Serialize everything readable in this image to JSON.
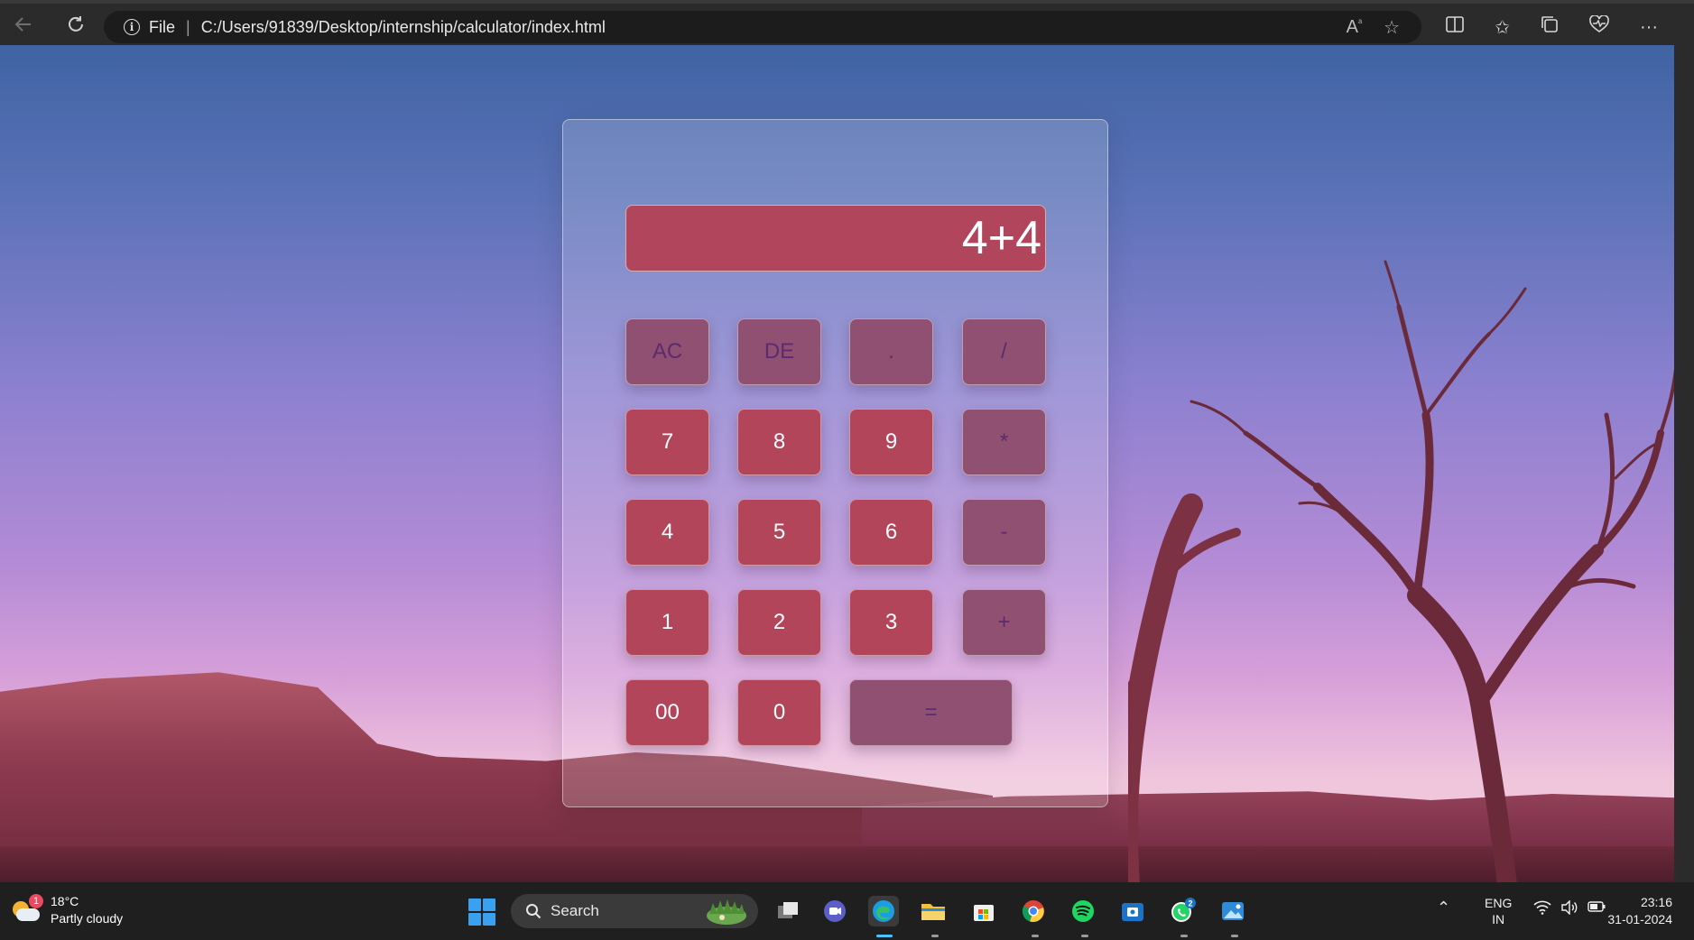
{
  "browser": {
    "url_prefix": "File",
    "url": "C:/Users/91839/Desktop/internship/calculator/index.html"
  },
  "calculator": {
    "display_value": "4+4",
    "keys": {
      "ac": "AC",
      "de": "DE",
      "dot": ".",
      "divide": "/",
      "seven": "7",
      "eight": "8",
      "nine": "9",
      "multiply": "*",
      "four": "4",
      "five": "5",
      "six": "6",
      "minus": "-",
      "one": "1",
      "two": "2",
      "three": "3",
      "plus": "+",
      "double_zero": "00",
      "zero": "0",
      "equals": "="
    },
    "colors": {
      "number_key": "#b3455a",
      "operator_key": "#8f5072",
      "display_bg": "#b0455b"
    }
  },
  "taskbar": {
    "weather": {
      "temperature": "18°C",
      "condition": "Partly cloudy",
      "badge": "1"
    },
    "search_label": "Search",
    "whatsapp_badge": "2",
    "language_top": "ENG",
    "language_bottom": "IN",
    "time": "23:16",
    "date": "31-01-2024"
  }
}
